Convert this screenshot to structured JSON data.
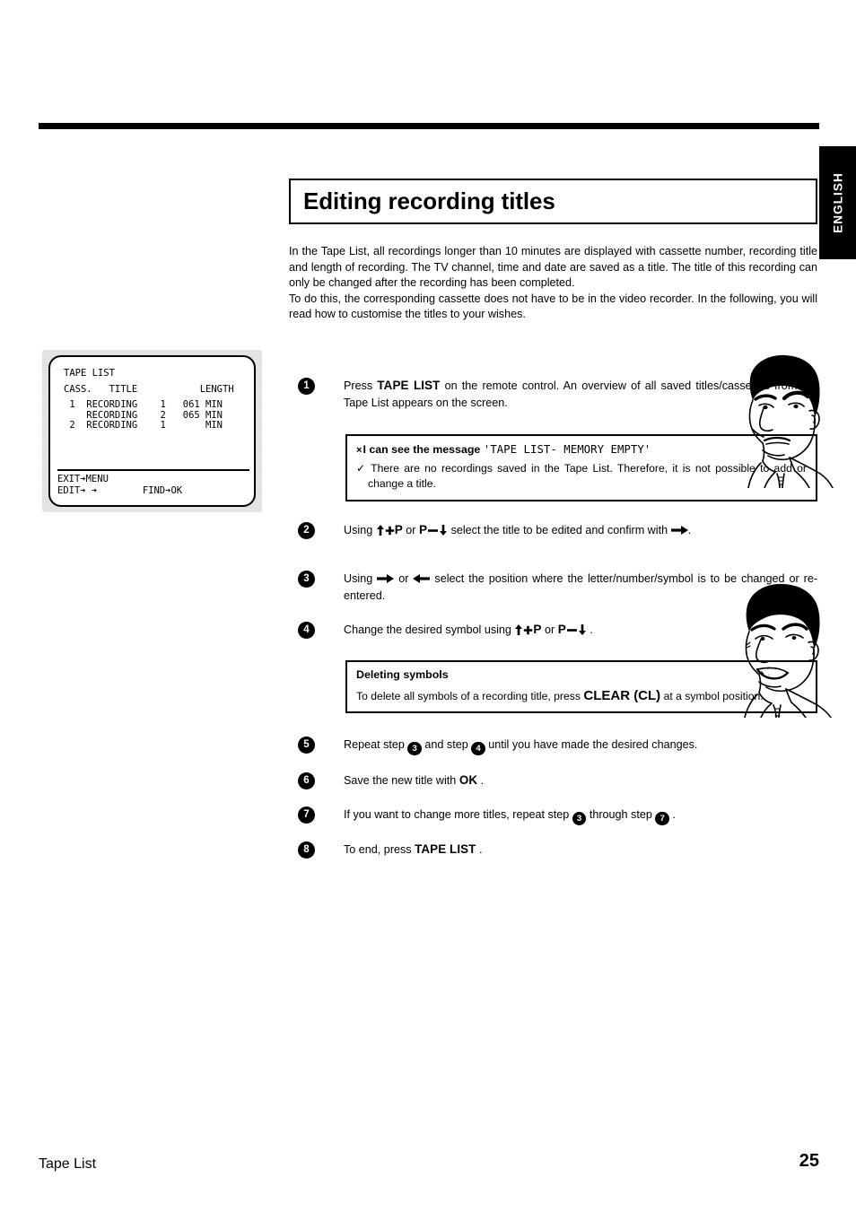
{
  "language_tab": "ENGLISH",
  "header": {
    "title": "Editing recording titles"
  },
  "intro": {
    "p1": "In the Tape List, all recordings longer than 10 minutes are displayed with cassette number, recording title and length of recording. The TV channel, time and date are saved as a title. The title of this recording can only be changed after the recording has been completed.",
    "p2": "To do this, the corresponding cassette does not have to be in the video recorder. In the following, you will read how to customise the titles to your wishes."
  },
  "tv_screen": {
    "title": "TAPE LIST",
    "columns": "CASS.   TITLE           LENGTH",
    "rows": [
      " 1  RECORDING    1   061 MIN",
      "    RECORDING    2   065 MIN",
      " 2  RECORDING    1       MIN"
    ],
    "footer_line1": "EXIT➔MENU",
    "footer_line2_left": "EDIT➔ ➔",
    "footer_line2_right": "FIND➔OK"
  },
  "steps": [
    {
      "num": "1",
      "text_before": "Press",
      "key": "TAPE LIST",
      "text_after": "on the remote control. An overview of all saved titles/cassettes from the Tape List appears on the screen."
    },
    {
      "num": "2",
      "using": "Using",
      "key_a": "↑+P",
      "or": "or",
      "key_b": "P−↓",
      "text_after": "select the title to be edited and confirm with",
      "confirm_key": "➔",
      "period": "."
    },
    {
      "num": "3",
      "using": "Using",
      "key_a": "➔",
      "or": "or",
      "key_b": "←",
      "text_after": "select the position where the letter/number/symbol is to be changed or re-entered."
    },
    {
      "num": "4",
      "text_before": "Change the desired symbol using",
      "key_a": "↑+P",
      "or": "or",
      "key_b": "P−↓",
      "period": "."
    },
    {
      "num": "5",
      "t1": "Repeat step",
      "ref1": "3",
      "t2": "and step",
      "ref2": "4",
      "t3": "until you have made the desired changes."
    },
    {
      "num": "6",
      "t1": "Save the new title with",
      "key": "OK",
      "t2": "."
    },
    {
      "num": "7",
      "t1": "If you want to change more titles, repeat step",
      "ref1": "3",
      "t2": "through step",
      "ref2": "7",
      "t3": "."
    },
    {
      "num": "8",
      "t1": "To end, press",
      "key": "TAPE LIST",
      "t2": "."
    }
  ],
  "info_box_memory_empty": {
    "x_mark": "×",
    "bold_text": "I can see the message",
    "quoted_message": "'TAPE LIST- MEMORY EMPTY'",
    "tick": "✓",
    "answer": "There are no recordings saved in the Tape List. Therefore, it is not possible to add or change a title."
  },
  "info_box_deleting": {
    "heading": "Deleting symbols",
    "text_before": "To delete all symbols of a recording title, press",
    "key": "CLEAR (CL)",
    "text_after": "at a symbol position."
  },
  "footer": {
    "left": "Tape List",
    "page": "25"
  },
  "colors": {
    "ink": "#000000",
    "paper": "#ffffff",
    "tab_bg": "#000000",
    "tab_text": "#ffffff"
  }
}
